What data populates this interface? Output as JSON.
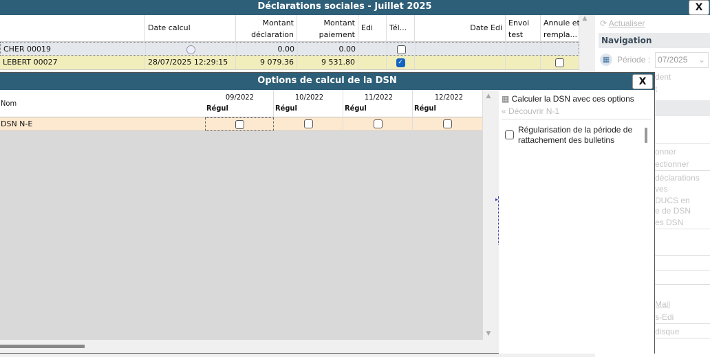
{
  "main": {
    "title": "Déclarations sociales - Juillet 2025",
    "close": "X",
    "columns": [
      "",
      "Date calcul",
      "Montant\ndéclaration",
      "Montant\npaiement",
      "Edi",
      "Tél...",
      "Date Edi",
      "Envoi\ntest",
      "Annule et\nrempla..."
    ],
    "rows": [
      {
        "name": "CHER 00019",
        "date": "",
        "decl": "0.00",
        "paie": "0.00",
        "tel": false,
        "annule": null
      },
      {
        "name": "LEBERT 00027",
        "date": "28/07/2025 12:29:15",
        "decl": "9 079.36",
        "paie": "9 531.80",
        "tel": true,
        "annule": false
      }
    ]
  },
  "sidebar": {
    "refresh": "Actualiser",
    "navigation": "Navigation",
    "periode_label": "Période :",
    "periode_value": "07/2025",
    "fragments": [
      "dent",
      "t",
      "onner",
      "ectionner",
      "déclarations",
      "ves",
      "DUCS en",
      "e de DSN",
      "es DSN",
      "Mail",
      "s-Edi",
      "disque"
    ]
  },
  "dialog": {
    "title": "Options de calcul de la DSN",
    "close": "X",
    "nom_header": "Nom",
    "periods": [
      {
        "month": "09/2022",
        "sub": "Régul"
      },
      {
        "month": "10/2022",
        "sub": "Régul"
      },
      {
        "month": "11/2022",
        "sub": "Régul"
      },
      {
        "month": "12/2022",
        "sub": "Régul"
      }
    ],
    "row": {
      "name": "DSN N-E",
      "checks": [
        false,
        false,
        false,
        false
      ]
    },
    "actions": {
      "calculate": "Calculer la DSN avec ces options",
      "discover": "Découvrir N-1"
    },
    "option": {
      "label": "Régularisation de la période de rattachement des bulletins",
      "checked": false
    }
  }
}
